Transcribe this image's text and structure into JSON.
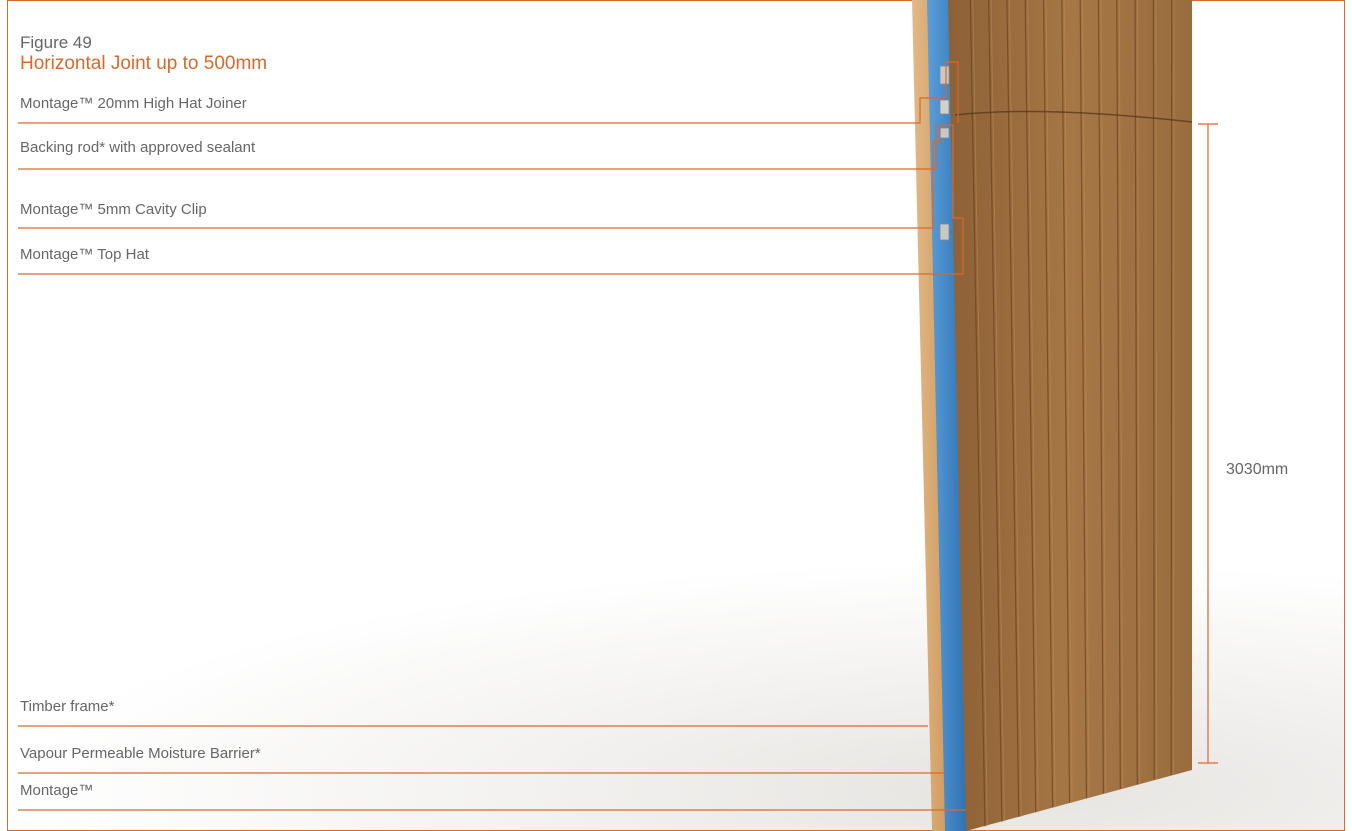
{
  "figure": {
    "label": "Figure 49",
    "title": "Horizontal Joint up to 500mm"
  },
  "callouts": [
    {
      "id": "high-hat-joiner",
      "text": "Montage™ 20mm High Hat Joiner"
    },
    {
      "id": "backing-rod",
      "text": "Backing rod* with approved sealant"
    },
    {
      "id": "cavity-clip",
      "text": "Montage™ 5mm Cavity Clip"
    },
    {
      "id": "top-hat",
      "text": "Montage™ Top Hat"
    },
    {
      "id": "timber-frame",
      "text": "Timber frame*"
    },
    {
      "id": "moisture-barrier",
      "text": "Vapour Permeable Moisture Barrier*"
    },
    {
      "id": "montage-cladding",
      "text": "Montage™"
    }
  ],
  "dimension": {
    "label": "3030mm"
  },
  "colors": {
    "accent": "#d9692a",
    "text": "#666666",
    "timber": "#d6a46a",
    "barrier": "#3f86c9",
    "cladding": "#9a6d3f"
  }
}
